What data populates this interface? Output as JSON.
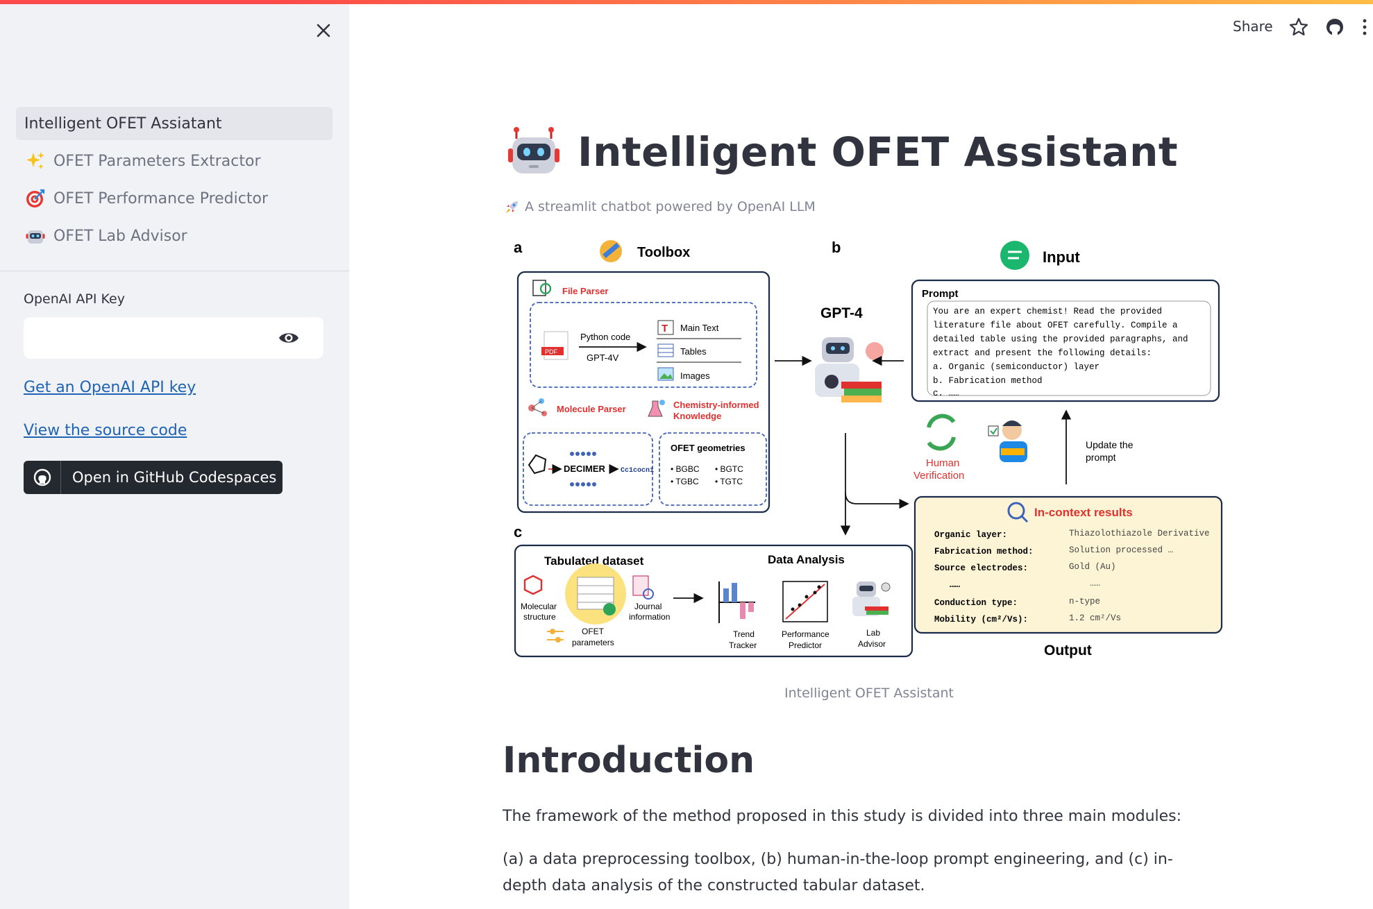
{
  "sidebar": {
    "nav": [
      {
        "label": "Intelligent OFET Assiatant",
        "icon": "",
        "active": true
      },
      {
        "label": "OFET Parameters Extractor",
        "icon": "sparkles-icon",
        "active": false
      },
      {
        "label": "OFET Performance Predictor",
        "icon": "target-icon",
        "active": false
      },
      {
        "label": "OFET Lab Advisor",
        "icon": "robot-icon",
        "active": false
      }
    ],
    "api_key_label": "OpenAI API Key",
    "api_key_value": "",
    "link_get_key": "Get an OpenAI API key",
    "link_source": "View the source code",
    "codespaces_button": "Open in GitHub Codespaces"
  },
  "header": {
    "share": "Share"
  },
  "main": {
    "title": "Intelligent OFET Assistant",
    "subtitle": "A streamlit chatbot powered by OpenAI LLM",
    "figure_caption": "Intelligent OFET Assistant",
    "intro_heading": "Introduction",
    "paragraph_1": "The framework of the method proposed in this study is divided into three main modules:",
    "paragraph_2": "(a) a data preprocessing toolbox, (b) human-in-the-loop prompt engineering, and (c) in-depth data analysis of the constructed tabular dataset."
  },
  "figure": {
    "panel_a": "a",
    "panel_b": "b",
    "panel_c": "c",
    "toolbox": "Toolbox",
    "file_parser": "File Parser",
    "python_code": "Python code",
    "gpt4v": "GPT-4V",
    "main_text": "Main Text",
    "tables": "Tables",
    "images": "Images",
    "pdf": "PDF",
    "molecule_parser": "Molecule Parser",
    "chem_knowledge_1": "Chemistry-informed",
    "chem_knowledge_2": "Knowledge",
    "decimer": "DECIMER",
    "smiles": "Cc1cocn1",
    "ofet_geometries": "OFET geometries",
    "geo_1": "BGBC",
    "geo_2": "BGTC",
    "geo_3": "TGBC",
    "geo_4": "TGTC",
    "gpt4": "GPT-4",
    "input": "Input",
    "prompt": "Prompt",
    "prompt_lines": [
      "You are an expert chemist! Read the provided",
      "literature file about OFET carefully. Compile a",
      "detailed table using the provided paragraphs, and",
      "extract and present the following details:",
      "a. Organic (semiconductor) layer",
      "b. Fabrication method",
      "c. ……"
    ],
    "human_1": "Human",
    "human_2": "Verification",
    "update_1": "Update the",
    "update_2": "prompt",
    "in_context": "In-context results",
    "results": [
      {
        "k": "Organic layer:",
        "v": "Thiazolothiazole Derivative"
      },
      {
        "k": "Fabrication method:",
        "v": "Solution processed …"
      },
      {
        "k": "Source electrodes:",
        "v": "Gold (Au)"
      },
      {
        "k": "……",
        "v": "……"
      },
      {
        "k": "Conduction type:",
        "v": "n-type"
      },
      {
        "k": "Mobility (cm²/Vs):",
        "v": "1.2 cm²/Vs"
      }
    ],
    "output": "Output",
    "tabulated": "Tabulated dataset",
    "data_analysis": "Data Analysis",
    "mol_1": "Molecular",
    "mol_2": "structure",
    "journal_1": "Journal",
    "journal_2": "information",
    "params_1": "OFET",
    "params_2": "parameters",
    "trend_1": "Trend",
    "trend_2": "Tracker",
    "perf_1": "Performance",
    "perf_2": "Predictor",
    "lab_1": "Lab",
    "lab_2": "Advisor"
  },
  "colors": {
    "accent_red": "#ff4b4b",
    "link_blue": "#1f63b5",
    "sidebar_bg": "#f0f2f6",
    "fig_red": "#e0312f"
  }
}
